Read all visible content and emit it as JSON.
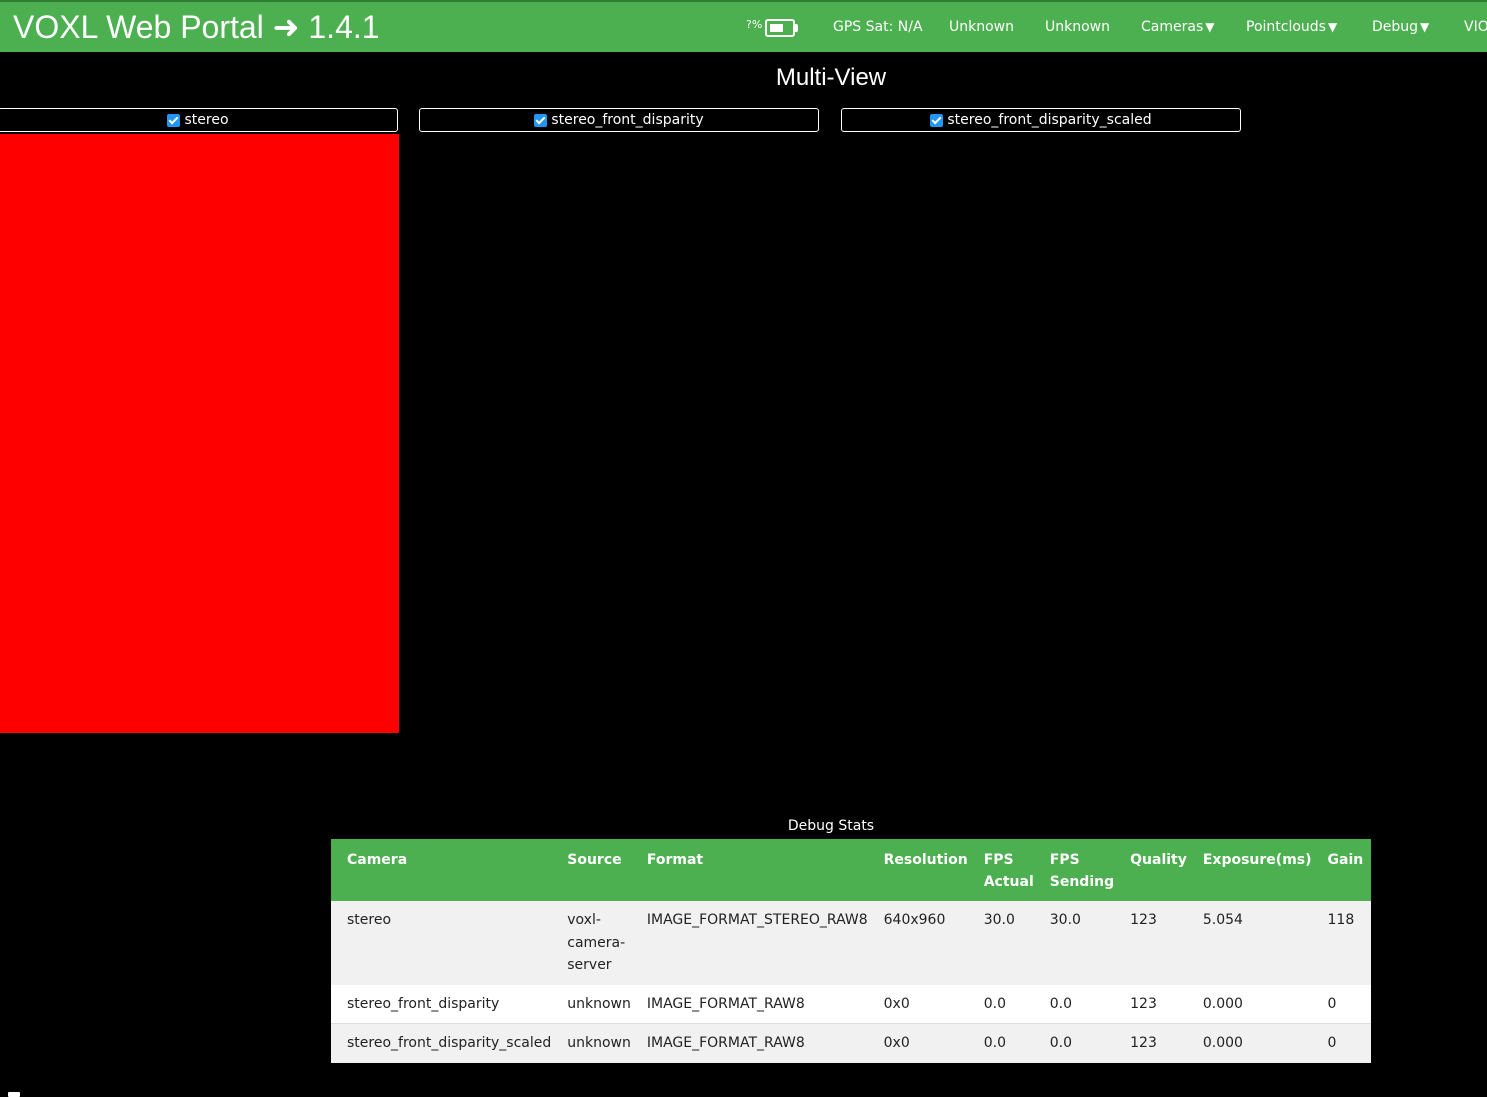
{
  "header": {
    "title": "VOXL Web Portal ➜ 1.4.1",
    "battery_pct": "?%",
    "gps": "GPS Sat: N/A",
    "status1": "Unknown",
    "status2": "Unknown",
    "menus": [
      {
        "label": "Cameras",
        "caret": "▼"
      },
      {
        "label": "Pointclouds",
        "caret": "▼"
      },
      {
        "label": "Debug",
        "caret": "▼"
      },
      {
        "label": "VIO"
      }
    ]
  },
  "main": {
    "title": "Multi-View",
    "camera_tabs": [
      {
        "label": "stereo",
        "checked": true
      },
      {
        "label": "stereo_front_disparity",
        "checked": true
      },
      {
        "label": "stereo_front_disparity_scaled",
        "checked": true
      }
    ],
    "video_color": "#ff0000"
  },
  "debug_stats": {
    "caption": "Debug Stats",
    "columns": [
      "Camera",
      "Source",
      "Format",
      "Resolution",
      "FPS Actual",
      "FPS Sending",
      "Quality",
      "Exposure(ms)",
      "Gain"
    ],
    "rows": [
      [
        "stereo",
        "voxl-camera-server",
        "IMAGE_FORMAT_STEREO_RAW8",
        "640x960",
        "30.0",
        "30.0",
        "123",
        "5.054",
        "118"
      ],
      [
        "stereo_front_disparity",
        "unknown",
        "IMAGE_FORMAT_RAW8",
        "0x0",
        "0.0",
        "0.0",
        "123",
        "0.000",
        "0"
      ],
      [
        "stereo_front_disparity_scaled",
        "unknown",
        "IMAGE_FORMAT_RAW8",
        "0x0",
        "0.0",
        "0.0",
        "123",
        "0.000",
        "0"
      ]
    ]
  },
  "colors": {
    "accent": "#4caf50",
    "checkbox": "#2196f3"
  }
}
